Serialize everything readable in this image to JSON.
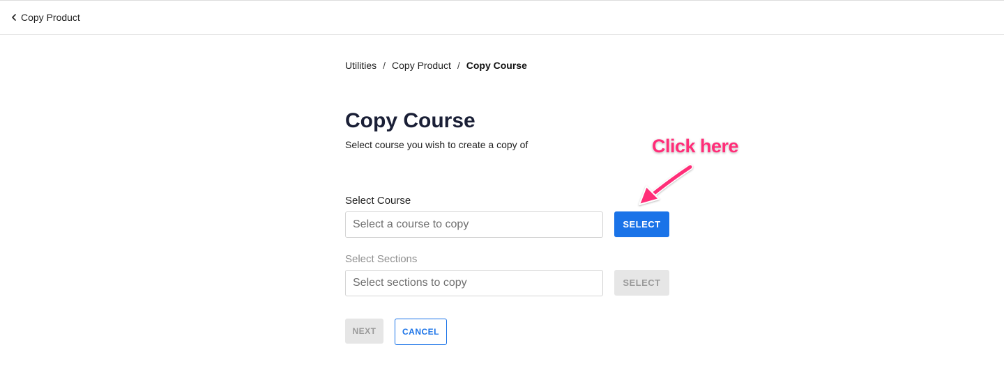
{
  "topbar": {
    "back_label": "Copy Product"
  },
  "breadcrumb": {
    "items": [
      "Utilities",
      "Copy Product"
    ],
    "separator": "/",
    "current": "Copy Course"
  },
  "page": {
    "title": "Copy Course",
    "subtitle": "Select course you wish to create a copy of"
  },
  "course_field": {
    "label": "Select Course",
    "placeholder": "Select a course to copy",
    "value": "",
    "button_label": "SELECT"
  },
  "sections_field": {
    "label": "Select Sections",
    "placeholder": "Select sections to copy",
    "value": "",
    "button_label": "SELECT"
  },
  "actions": {
    "next_label": "NEXT",
    "cancel_label": "CANCEL"
  },
  "annotation": {
    "text": "Click here",
    "color": "#ff2d78"
  },
  "colors": {
    "primary": "#1a73e8",
    "disabled_bg": "#e6e6e6",
    "disabled_text": "#9a9a9a"
  },
  "icons": {
    "back": "chevron-left-icon",
    "annotation_arrow": "arrow-icon"
  }
}
